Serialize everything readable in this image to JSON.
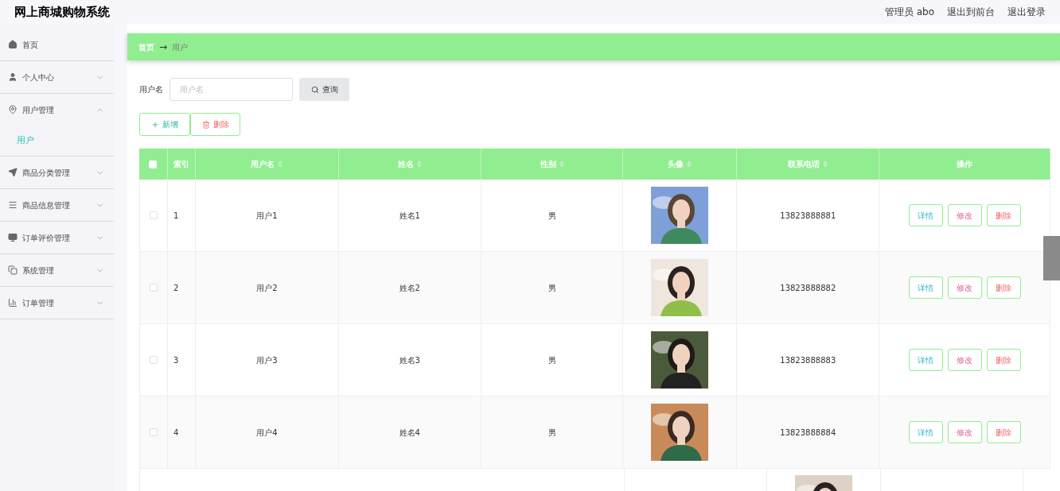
{
  "header": {
    "title": "网上商城购物系统",
    "user": "管理员 abo",
    "links": [
      "退出到前台",
      "退出登录"
    ]
  },
  "sidebar": {
    "items": [
      {
        "label": "首页",
        "has_arrow": false
      },
      {
        "label": "个人中心",
        "expanded": false,
        "has_arrow": true
      },
      {
        "label": "用户管理",
        "expanded": true,
        "has_arrow": true,
        "children": [
          {
            "label": "用户",
            "selected": true
          }
        ]
      },
      {
        "label": "商品分类管理",
        "expanded": false,
        "has_arrow": true
      },
      {
        "label": "商品信息管理",
        "expanded": false,
        "has_arrow": true
      },
      {
        "label": "订单评价管理",
        "expanded": false,
        "has_arrow": true
      },
      {
        "label": "系统管理",
        "expanded": false,
        "has_arrow": true
      },
      {
        "label": "订单管理",
        "expanded": false,
        "has_arrow": true
      }
    ]
  },
  "breadcrumb": {
    "home": "首页",
    "separator": "→",
    "current": "用户"
  },
  "search": {
    "label": "用户名",
    "placeholder": "用户名",
    "button": "查询"
  },
  "actions": {
    "add": "新增",
    "delete": "删除"
  },
  "table": {
    "select_all_checked": false,
    "columns": [
      {
        "label": "索引",
        "sortable": false
      },
      {
        "label": "用户名",
        "sortable": true
      },
      {
        "label": "姓名",
        "sortable": true
      },
      {
        "label": "性别",
        "sortable": true
      },
      {
        "label": "头像",
        "sortable": true
      },
      {
        "label": "联系电话",
        "sortable": true
      },
      {
        "label": "操作",
        "sortable": false
      }
    ],
    "rows": [
      {
        "index": "1",
        "username": "用户1",
        "name": "姓名1",
        "gender": "男",
        "phone": "13823888881",
        "checked": false,
        "buttons": [
          "详情",
          "修改",
          "删除"
        ]
      },
      {
        "index": "2",
        "username": "用户2",
        "name": "姓名2",
        "gender": "男",
        "phone": "13823888882",
        "checked": false,
        "buttons": [
          "详情",
          "修改",
          "删除"
        ]
      },
      {
        "index": "3",
        "username": "用户3",
        "name": "姓名3",
        "gender": "男",
        "phone": "13823888883",
        "checked": false,
        "buttons": [
          "详情",
          "修改",
          "删除"
        ]
      },
      {
        "index": "4",
        "username": "用户4",
        "name": "姓名4",
        "gender": "男",
        "phone": "13823888884",
        "checked": false,
        "buttons": [
          "详情",
          "修改",
          "删除"
        ]
      }
    ]
  }
}
